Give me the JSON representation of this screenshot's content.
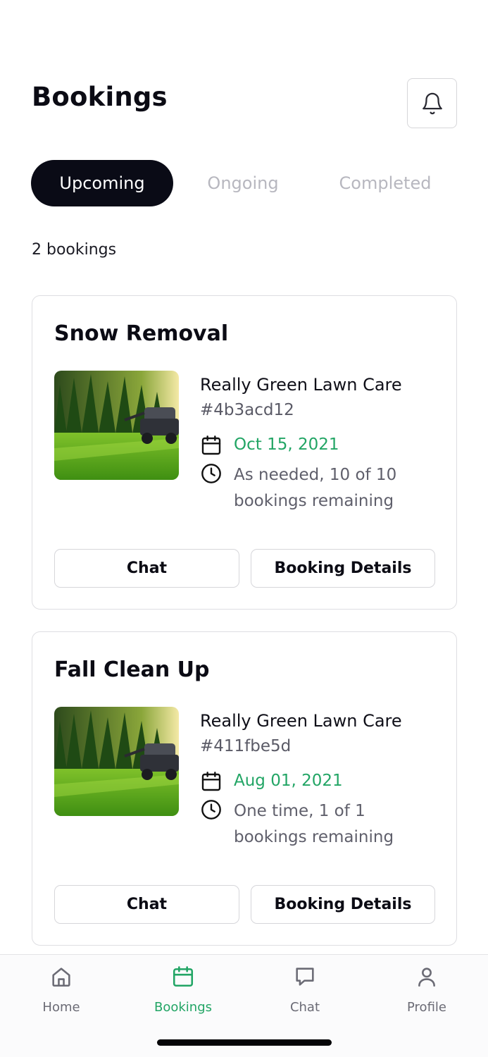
{
  "header": {
    "title": "Bookings",
    "notification_icon": "bell-icon"
  },
  "tabs": [
    {
      "label": "Upcoming",
      "active": true
    },
    {
      "label": "Ongoing",
      "active": false
    },
    {
      "label": "Completed",
      "active": false
    }
  ],
  "summary": {
    "count_text": "2 bookings"
  },
  "bookings": [
    {
      "title": "Snow Removal",
      "provider": "Really Green Lawn Care",
      "reference": "#4b3acd12",
      "date": "Oct 15, 2021",
      "schedule": "As needed, 10 of 10 bookings remaining",
      "chat_label": "Chat",
      "details_label": "Booking Details"
    },
    {
      "title": "Fall Clean Up",
      "provider": "Really Green Lawn Care",
      "reference": "#411fbe5d",
      "date": "Aug 01, 2021",
      "schedule": "One time, 1 of 1 bookings remaining",
      "chat_label": "Chat",
      "details_label": "Booking Details"
    }
  ],
  "nav": {
    "items": [
      {
        "label": "Home",
        "icon": "home-icon",
        "active": false
      },
      {
        "label": "Bookings",
        "icon": "calendar-icon",
        "active": true
      },
      {
        "label": "Chat",
        "icon": "chat-bubble-icon",
        "active": false
      },
      {
        "label": "Profile",
        "icon": "user-icon",
        "active": false
      }
    ]
  },
  "colors": {
    "accent": "#22a565",
    "active_tab_bg": "#0a0b16",
    "inactive_tab_text": "#b7b7bf",
    "border": "#dedee2"
  }
}
